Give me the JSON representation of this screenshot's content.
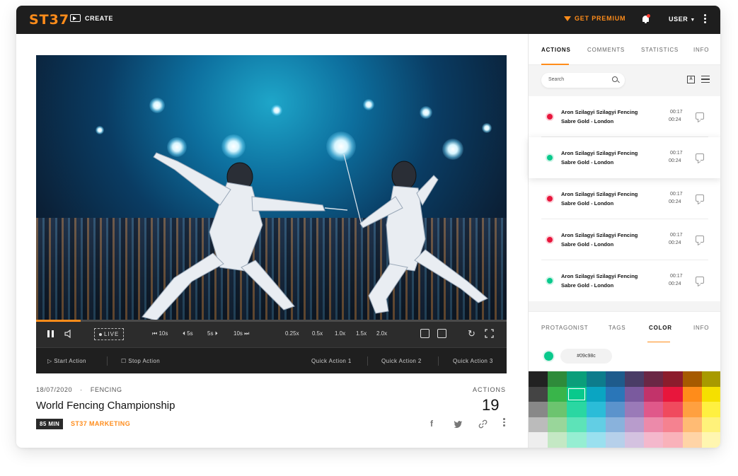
{
  "topbar": {
    "logo": "ST37",
    "create_label": "CREATE",
    "premium_label": "GET PREMIUM",
    "user_label": "USER"
  },
  "player": {
    "progress_fraction": 0.095,
    "live_label": "LIVE",
    "seek_controls": [
      "10s",
      "5s",
      "5s",
      "10s"
    ],
    "speeds": [
      "0.25x",
      "0.5x",
      "1.0x",
      "1.5x",
      "2.0x"
    ],
    "actionbar": {
      "start": "Start Action",
      "stop": "Stop Action",
      "quick": [
        "Quick Action 1",
        "Quick Action 2",
        "Quick Action 3"
      ]
    }
  },
  "meta": {
    "date": "18/07/2020",
    "category": "FENCING",
    "title": "World Fencing Championship",
    "duration_badge": "85 MIN",
    "owner": "ST37 MARKETING",
    "actions_label": "ACTIONS",
    "actions_count": "19"
  },
  "panel": {
    "tabs": [
      "ACTIONS",
      "COMMENTS",
      "STATISTICS",
      "INFO"
    ],
    "active_tab": "ACTIONS",
    "search_placeholder": "Search",
    "items": [
      {
        "name": "Aron Szilagyi Szilagyi Fencing",
        "sub": "Sabre Gold - London",
        "t1": "00:17",
        "t2": "00:24",
        "color": "#e8163c"
      },
      {
        "name": "Aron Szilagyi Szilagyi Fencing",
        "sub": "Sabre Gold - London",
        "t1": "00:17",
        "t2": "00:24",
        "color": "#09c98c"
      },
      {
        "name": "Aron Szilagyi Szilagyi Fencing",
        "sub": "Sabre Gold - London",
        "t1": "00:17",
        "t2": "00:24",
        "color": "#e8163c"
      },
      {
        "name": "Aron Szilagyi Szilagyi Fencing",
        "sub": "Sabre Gold - London",
        "t1": "00:17",
        "t2": "00:24",
        "color": "#e8163c"
      },
      {
        "name": "Aron Szilagyi Szilagyi Fencing",
        "sub": "Sabre Gold - London",
        "t1": "00:17",
        "t2": "00:24",
        "color": "#09c98c"
      }
    ],
    "tabs2": [
      "PROTAGONIST",
      "TAGS",
      "COLOR",
      "INFO"
    ],
    "active_tab2": "COLOR",
    "current_color": "#09c98c",
    "palette": [
      [
        "#222222",
        "#2e8b3a",
        "#0a9e7a",
        "#0d7c8c",
        "#1e5b8c",
        "#4a3c66",
        "#6b2745",
        "#8c1c2c",
        "#a65a00",
        "#a89a00"
      ],
      [
        "#444444",
        "#39b54a",
        "#09c98c",
        "#0aa5c2",
        "#2a76b8",
        "#7a5a9e",
        "#c2336a",
        "#e8163c",
        "#ff8c1a",
        "#f5e000"
      ],
      [
        "#888888",
        "#6cc46f",
        "#2ad7a2",
        "#2bbcd8",
        "#5b93cc",
        "#9a7ab8",
        "#e0588a",
        "#f04a5e",
        "#ffa040",
        "#fff040"
      ],
      [
        "#bbbbbb",
        "#99d69a",
        "#5de3b8",
        "#62cee4",
        "#89b2dc",
        "#b89ccc",
        "#ec8aaa",
        "#f58290",
        "#ffbb74",
        "#fff27a"
      ],
      [
        "#eeeeee",
        "#c4e8c4",
        "#96eed2",
        "#9ae0ef",
        "#b6d0ea",
        "#d4c2e0",
        "#f4b8cc",
        "#f9b2ba",
        "#ffd4a6",
        "#fff6b0"
      ]
    ]
  },
  "colors": {
    "accent": "#ff8c1a",
    "topbar_bg": "#1e1e1e",
    "red": "#e8163c",
    "green": "#09c98c"
  }
}
